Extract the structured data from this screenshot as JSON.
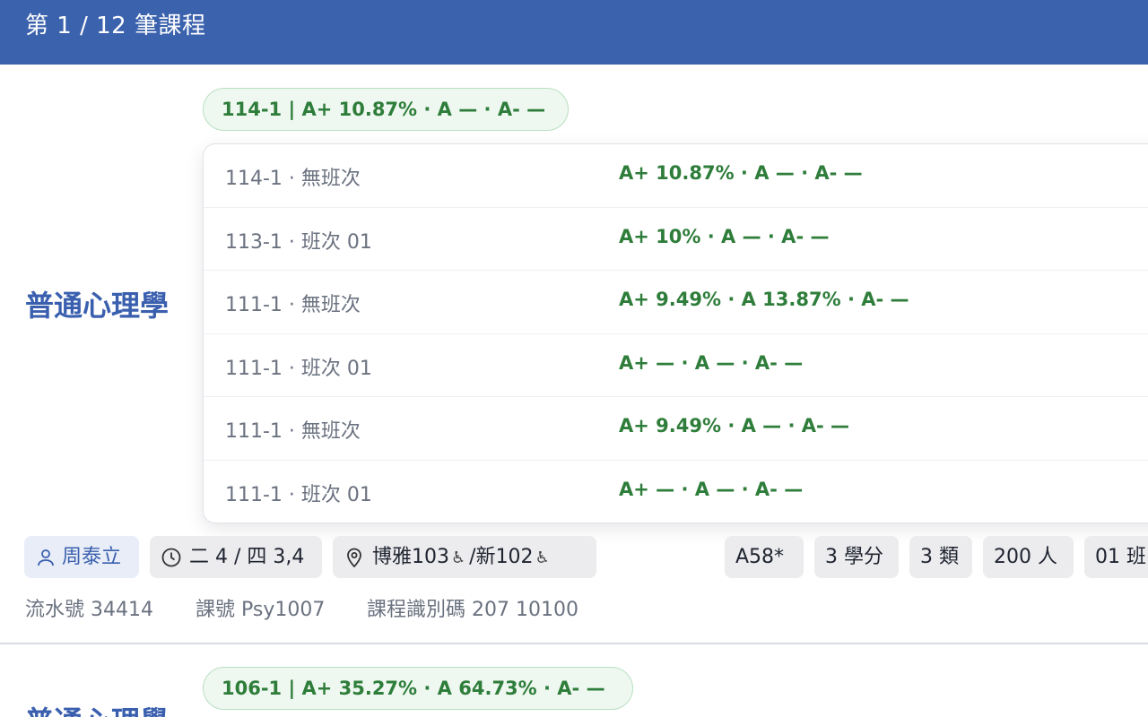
{
  "header": {
    "title": "第 1 / 12 筆課程"
  },
  "courses": [
    {
      "title": "普通心理學",
      "grade_summary": "114-1 | A+ 10.87% · A — · A- —",
      "history": [
        {
          "term": "114-1 · 無班次",
          "grades": "A+ 10.87% · A — · A- —"
        },
        {
          "term": "113-1 · 班次 01",
          "grades": "A+ 10% · A — · A- —"
        },
        {
          "term": "111-1 · 無班次",
          "grades": "A+ 9.49% · A 13.87% · A- —"
        },
        {
          "term": "111-1 · 班次 01",
          "grades": "A+ — · A — · A- —"
        },
        {
          "term": "111-1 · 無班次",
          "grades": "A+ 9.49% · A — · A- —"
        },
        {
          "term": "111-1 · 班次 01",
          "grades": "A+ — · A — · A- —"
        }
      ],
      "teacher": "周泰立",
      "time": "二 4 / 四 3,4",
      "room_1": "博雅103",
      "room_sep": "/",
      "room_2": "新102",
      "accessible_symbol": "♿",
      "tags": {
        "code": "A58*",
        "credits": "3 學分",
        "type": "3 類",
        "people": "200 人",
        "class": "01 班"
      },
      "meta": {
        "serial": "流水號 34414",
        "course_no": "課號 Psy1007",
        "course_id": "課程識別碼 207 10100"
      }
    },
    {
      "title": "普通心理學",
      "grade_summary": "106-1 | A+ 35.27% · A 64.73% · A- —"
    }
  ],
  "icons": {
    "teacher": "person-icon",
    "time": "clock-icon",
    "room": "location-pin-icon",
    "accessible": "wheelchair-icon"
  },
  "colors": {
    "header_bg": "#3b62ad",
    "title": "#3a5fae",
    "grade_green": "#2e7d3a",
    "pill_bg": "#eef8f0"
  }
}
